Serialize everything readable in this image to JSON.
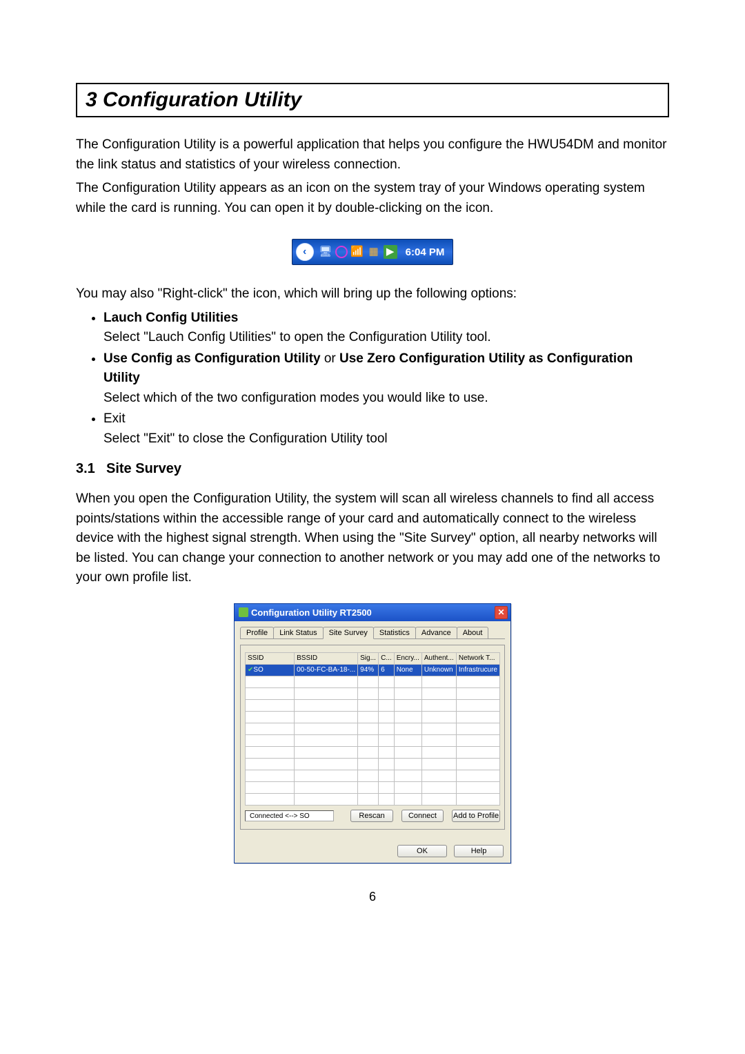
{
  "chapter_heading": "3  Configuration Utility",
  "intro_p1": "The Configuration Utility is a powerful application that helps you configure the HWU54DM and monitor the link status and statistics of your wireless connection.",
  "intro_p2": "The Configuration Utility appears as an icon on the system tray of your Windows operating system while the card is running. You can open it by double-clicking on the icon.",
  "tray": {
    "time": "6:04 PM",
    "icons": [
      "network-icon",
      "antivirus-icon",
      "wifi-icon",
      "link-icon",
      "security-icon"
    ]
  },
  "rclick_intro": "You may also \"Right-click\" the icon, which will bring up the following options:",
  "bullets": [
    {
      "title": "Lauch Config Utilities",
      "title_bold": true,
      "desc": "Select \"Lauch Config Utilities\" to open the Configuration Utility tool."
    },
    {
      "title_parts": [
        {
          "t": "Use Config as Configuration Utility",
          "b": true
        },
        {
          "t": " or ",
          "b": false
        },
        {
          "t": "Use Zero Configuration Utility as Configuration Utility",
          "b": true
        }
      ],
      "desc": "Select which of the two configuration modes you would like to use."
    },
    {
      "title": "Exit",
      "title_bold": false,
      "desc": "Select \"Exit\" to close the Configuration Utility tool"
    }
  ],
  "subsection_num": "3.1",
  "subsection_title": "Site Survey",
  "subsection_para": "When you open the Configuration Utility, the system will scan all wireless channels to find all access points/stations within the accessible range of your card and automatically connect to the wireless device with the highest signal strength. When using the \"Site Survey\" option, all nearby networks will be listed. You can change your connection to another network or you may add one of the networks to your own profile list.",
  "dialog": {
    "title": "Configuration Utility RT2500",
    "tabs": [
      "Profile",
      "Link Status",
      "Site Survey",
      "Statistics",
      "Advance",
      "About"
    ],
    "active_tab": 2,
    "columns": [
      "SSID",
      "BSSID",
      "Sig...",
      "C...",
      "Encry...",
      "Authent...",
      "Network T..."
    ],
    "rows": [
      {
        "ssid": "SO",
        "bssid": "00-50-FC-BA-18-...",
        "sig": "94%",
        "ch": "6",
        "enc": "None",
        "auth": "Unknown",
        "nt": "Infrastrucure"
      }
    ],
    "empty_rows": 11,
    "status": "Connected <--> SO",
    "buttons": {
      "rescan": "Rescan",
      "connect": "Connect",
      "add": "Add to Profile"
    },
    "footer": {
      "ok": "OK",
      "help": "Help"
    }
  },
  "page_number": "6"
}
